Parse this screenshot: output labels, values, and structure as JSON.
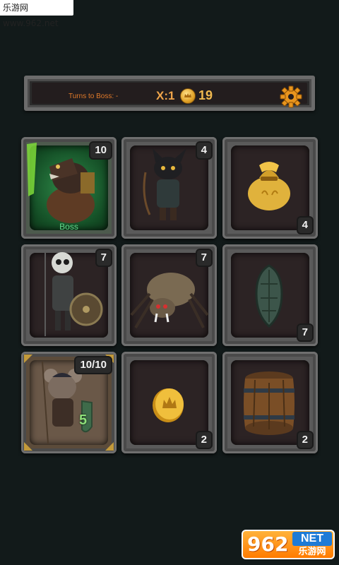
{
  "watermark": {
    "top": "乐游网 www.962.net",
    "bottom_num": "962",
    "bottom_net": "NET",
    "bottom_cn": "乐游网"
  },
  "header": {
    "turns_label": "Turns to Boss: -",
    "multiplier": "X:1",
    "coins": "19",
    "icons": {
      "coin": "coin-icon",
      "settings": "gear-icon"
    }
  },
  "cards": [
    {
      "id": "card-rat-boss",
      "icon": "rat-warrior-icon",
      "value": "10",
      "label": "Boss",
      "kind": "boss"
    },
    {
      "id": "card-cat-archer",
      "icon": "cat-archer-icon",
      "value": "4",
      "kind": "enemy"
    },
    {
      "id": "card-gold-bag",
      "icon": "gold-bag-icon",
      "value": "4",
      "kind": "item"
    },
    {
      "id": "card-skeleton",
      "icon": "skeleton-warrior-icon",
      "value": "7",
      "kind": "enemy"
    },
    {
      "id": "card-spider",
      "icon": "spider-icon",
      "value": "7",
      "kind": "enemy"
    },
    {
      "id": "card-shield",
      "icon": "shield-icon",
      "value": "7",
      "kind": "item"
    },
    {
      "id": "card-mouse-hero",
      "icon": "mouse-hero-icon",
      "health": "10/10",
      "defense": "5",
      "kind": "hero"
    },
    {
      "id": "card-coin",
      "icon": "coin-icon",
      "value": "2",
      "kind": "item"
    },
    {
      "id": "card-barrel",
      "icon": "barrel-icon",
      "value": "2",
      "kind": "item"
    }
  ],
  "colors": {
    "accent": "#e07a2a",
    "coin": "#f0b94f",
    "boss_green": "#62d88a",
    "background": "#121a1a"
  }
}
